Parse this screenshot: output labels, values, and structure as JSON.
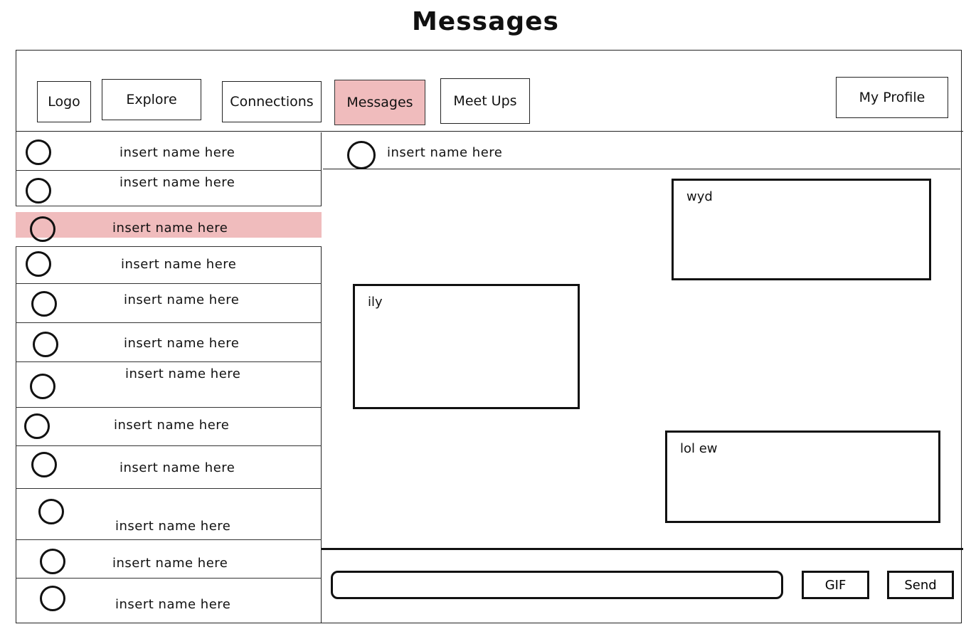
{
  "page": {
    "title": "Messages"
  },
  "nav": {
    "logo": "Logo",
    "explore": "Explore",
    "connections": "Connections",
    "messages": "Messages",
    "meetups": "Meet Ups",
    "profile": "My Profile",
    "active_tab": "Messages",
    "highlight_color": "#f0bcbd"
  },
  "conversations": [
    {
      "name": "insert name here"
    },
    {
      "name": "insert name here"
    },
    {
      "name": "insert name here",
      "selected": true
    },
    {
      "name": "insert name here"
    },
    {
      "name": "insert name here"
    },
    {
      "name": "insert name here"
    },
    {
      "name": "insert name here"
    },
    {
      "name": "insert name here"
    },
    {
      "name": "insert name here"
    },
    {
      "name": "insert name here"
    },
    {
      "name": "insert name here"
    },
    {
      "name": "insert name here"
    }
  ],
  "chat": {
    "contact_name": "insert name here",
    "messages": [
      {
        "text": "wyd",
        "side": "right"
      },
      {
        "text": "ily",
        "side": "left"
      },
      {
        "text": "lol ew",
        "side": "right"
      }
    ]
  },
  "composer": {
    "input_value": "",
    "gif_label": "GIF",
    "send_label": "Send"
  },
  "icons": {
    "avatar": "avatar-circle-icon"
  }
}
